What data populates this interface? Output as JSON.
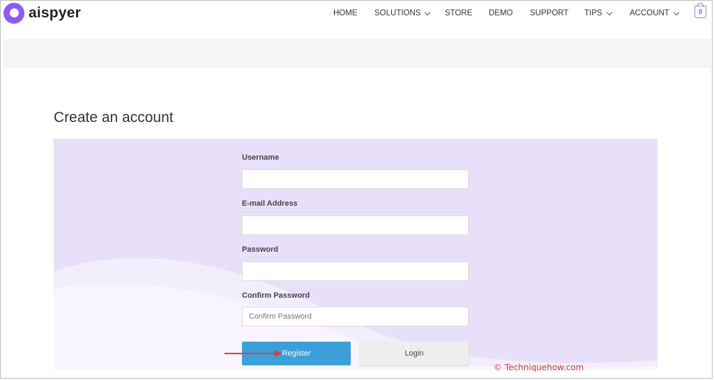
{
  "brand": {
    "name": "aispyer",
    "accent": "#8e5cf5"
  },
  "nav": {
    "items": [
      {
        "label": "HOME",
        "dropdown": false
      },
      {
        "label": "SOLUTIONS",
        "dropdown": true
      },
      {
        "label": "STORE",
        "dropdown": false
      },
      {
        "label": "DEMO",
        "dropdown": false
      },
      {
        "label": "SUPPORT",
        "dropdown": false
      },
      {
        "label": "TIPS",
        "dropdown": true
      },
      {
        "label": "ACCOUNT",
        "dropdown": true
      }
    ],
    "cart_count": "0"
  },
  "page": {
    "title": "Create an account"
  },
  "form": {
    "fields": [
      {
        "label": "Username",
        "value": "",
        "placeholder": ""
      },
      {
        "label": "E-mail Address",
        "value": "",
        "placeholder": ""
      },
      {
        "label": "Password",
        "value": "",
        "placeholder": ""
      },
      {
        "label": "Confirm Password",
        "value": "",
        "placeholder": "Confirm Password"
      }
    ],
    "register_label": "Register",
    "login_label": "Login",
    "register_color": "#3d9fd9",
    "panel_color": "#e8e0f8"
  },
  "watermark": "© Techniquehow.com"
}
